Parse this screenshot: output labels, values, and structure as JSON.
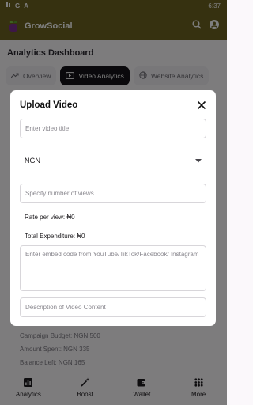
{
  "status_bar": {
    "time": "6:37",
    "g_label": "G",
    "a_label": "A"
  },
  "app_bar": {
    "title": "GrowSocial"
  },
  "page": {
    "title": "Analytics Dashboard"
  },
  "tabs": [
    {
      "label": "Overview"
    },
    {
      "label": "Video Analytics"
    },
    {
      "label": "Website Analytics"
    }
  ],
  "background_info": {
    "campaign_budget": "Campaign Budget: NGN 500",
    "amount_spent": "Amount Spent: NGN 335",
    "balance_left": "Balance Left: NGN 165"
  },
  "bottom_nav": [
    {
      "label": "Analytics"
    },
    {
      "label": "Boost"
    },
    {
      "label": "Wallet"
    },
    {
      "label": "More"
    }
  ],
  "dialog": {
    "title": "Upload Video",
    "video_title_placeholder": "Enter video title",
    "currency_selected": "NGN",
    "views_placeholder": "Specify number of views",
    "rate_per_view": "Rate per view: ₦0",
    "total_expenditure": "Total Expenditure: ₦0",
    "embed_placeholder": "Enter embed code from YouTube/TikTok/Facebook/ Instagram",
    "description_placeholder": "Description of Video Content"
  }
}
